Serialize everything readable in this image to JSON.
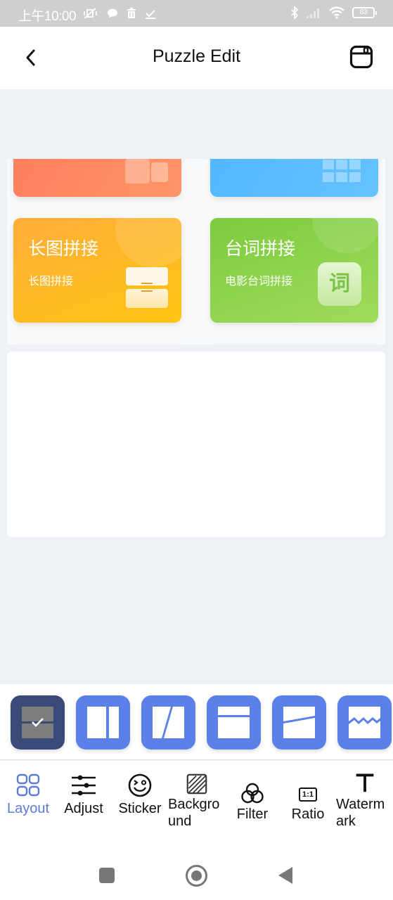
{
  "status_bar": {
    "time": "上午10:00",
    "left_icons": [
      "vibrate-off-icon",
      "chat-bubble-icon",
      "trash-icon",
      "download-done-icon"
    ],
    "right_icons": [
      "bluetooth-icon",
      "signal-icon",
      "wifi-icon"
    ],
    "battery": "83"
  },
  "header": {
    "title": "Puzzle Edit",
    "back_icon": "chevron-left-icon",
    "save_icon": "save-icon"
  },
  "preview": {
    "cards": [
      {
        "title": "",
        "subtitle": "",
        "color": "#ff8660"
      },
      {
        "title": "",
        "subtitle": "",
        "color": "#59bcff"
      },
      {
        "title": "长图拼接",
        "subtitle": "长图拼接",
        "color": "#ffb52a"
      },
      {
        "title": "台词拼接",
        "subtitle": "电影台词拼接",
        "color": "#8ed24c",
        "badge": "词"
      }
    ]
  },
  "layouts": [
    {
      "name": "horizontal-split",
      "selected": true
    },
    {
      "name": "vertical-split",
      "selected": false
    },
    {
      "name": "diagonal-split",
      "selected": false
    },
    {
      "name": "top-banner-split",
      "selected": false
    },
    {
      "name": "slanted-split",
      "selected": false
    },
    {
      "name": "zigzag-split",
      "selected": false
    }
  ],
  "toolbar": {
    "items": [
      {
        "label": "Layout",
        "icon": "grid-icon",
        "active": true
      },
      {
        "label": "Adjust",
        "icon": "sliders-icon",
        "active": false
      },
      {
        "label": "Sticker",
        "icon": "smiley-icon",
        "active": false
      },
      {
        "label": "Backgro\nund",
        "icon": "background-hatch-icon",
        "active": false
      },
      {
        "label": "Filter",
        "icon": "filter-circles-icon",
        "active": false
      },
      {
        "label": "Ratio",
        "icon": "ratio-icon",
        "active": false
      },
      {
        "label": "Waterm\nark",
        "icon": "text-t-icon",
        "active": false
      }
    ],
    "ratio_icon_text": "1:1"
  },
  "colors": {
    "accent": "#5b80e8",
    "selected_layout": "#3a4a78",
    "active_label": "#5b7bd8",
    "page_bg": "#edf1f6"
  }
}
